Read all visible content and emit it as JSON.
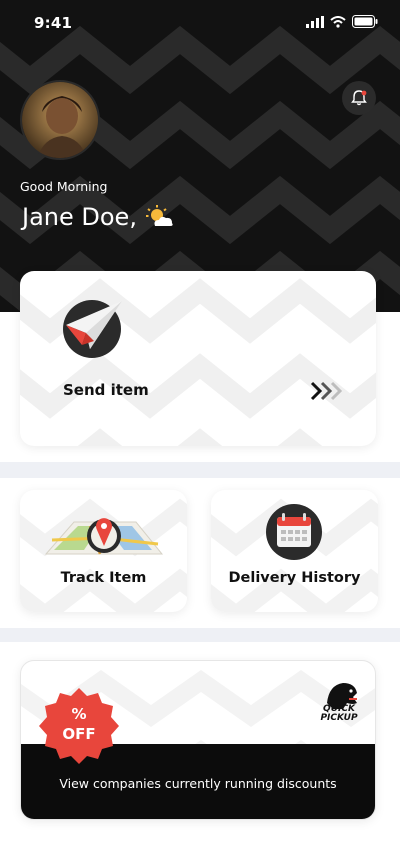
{
  "status_bar": {
    "time": "9:41"
  },
  "header": {
    "greeting": "Good Morning",
    "user_name": "Jane Doe,",
    "weather_icon": "partly-sunny-icon",
    "notification_icon": "bell-icon"
  },
  "actions": {
    "send": {
      "label": "Send item",
      "icon": "paper-plane-icon"
    },
    "track": {
      "label": "Track Item",
      "icon": "map-pin-icon"
    },
    "history": {
      "label": "Delivery History",
      "icon": "calendar-icon"
    }
  },
  "discount": {
    "badge": "%\nOFF",
    "brand": "QUICK\nPICKUP",
    "text": "View companies currently running discounts"
  },
  "colors": {
    "header_bg": "#121212",
    "accent_red": "#e8463c",
    "band": "#eef0f5"
  }
}
